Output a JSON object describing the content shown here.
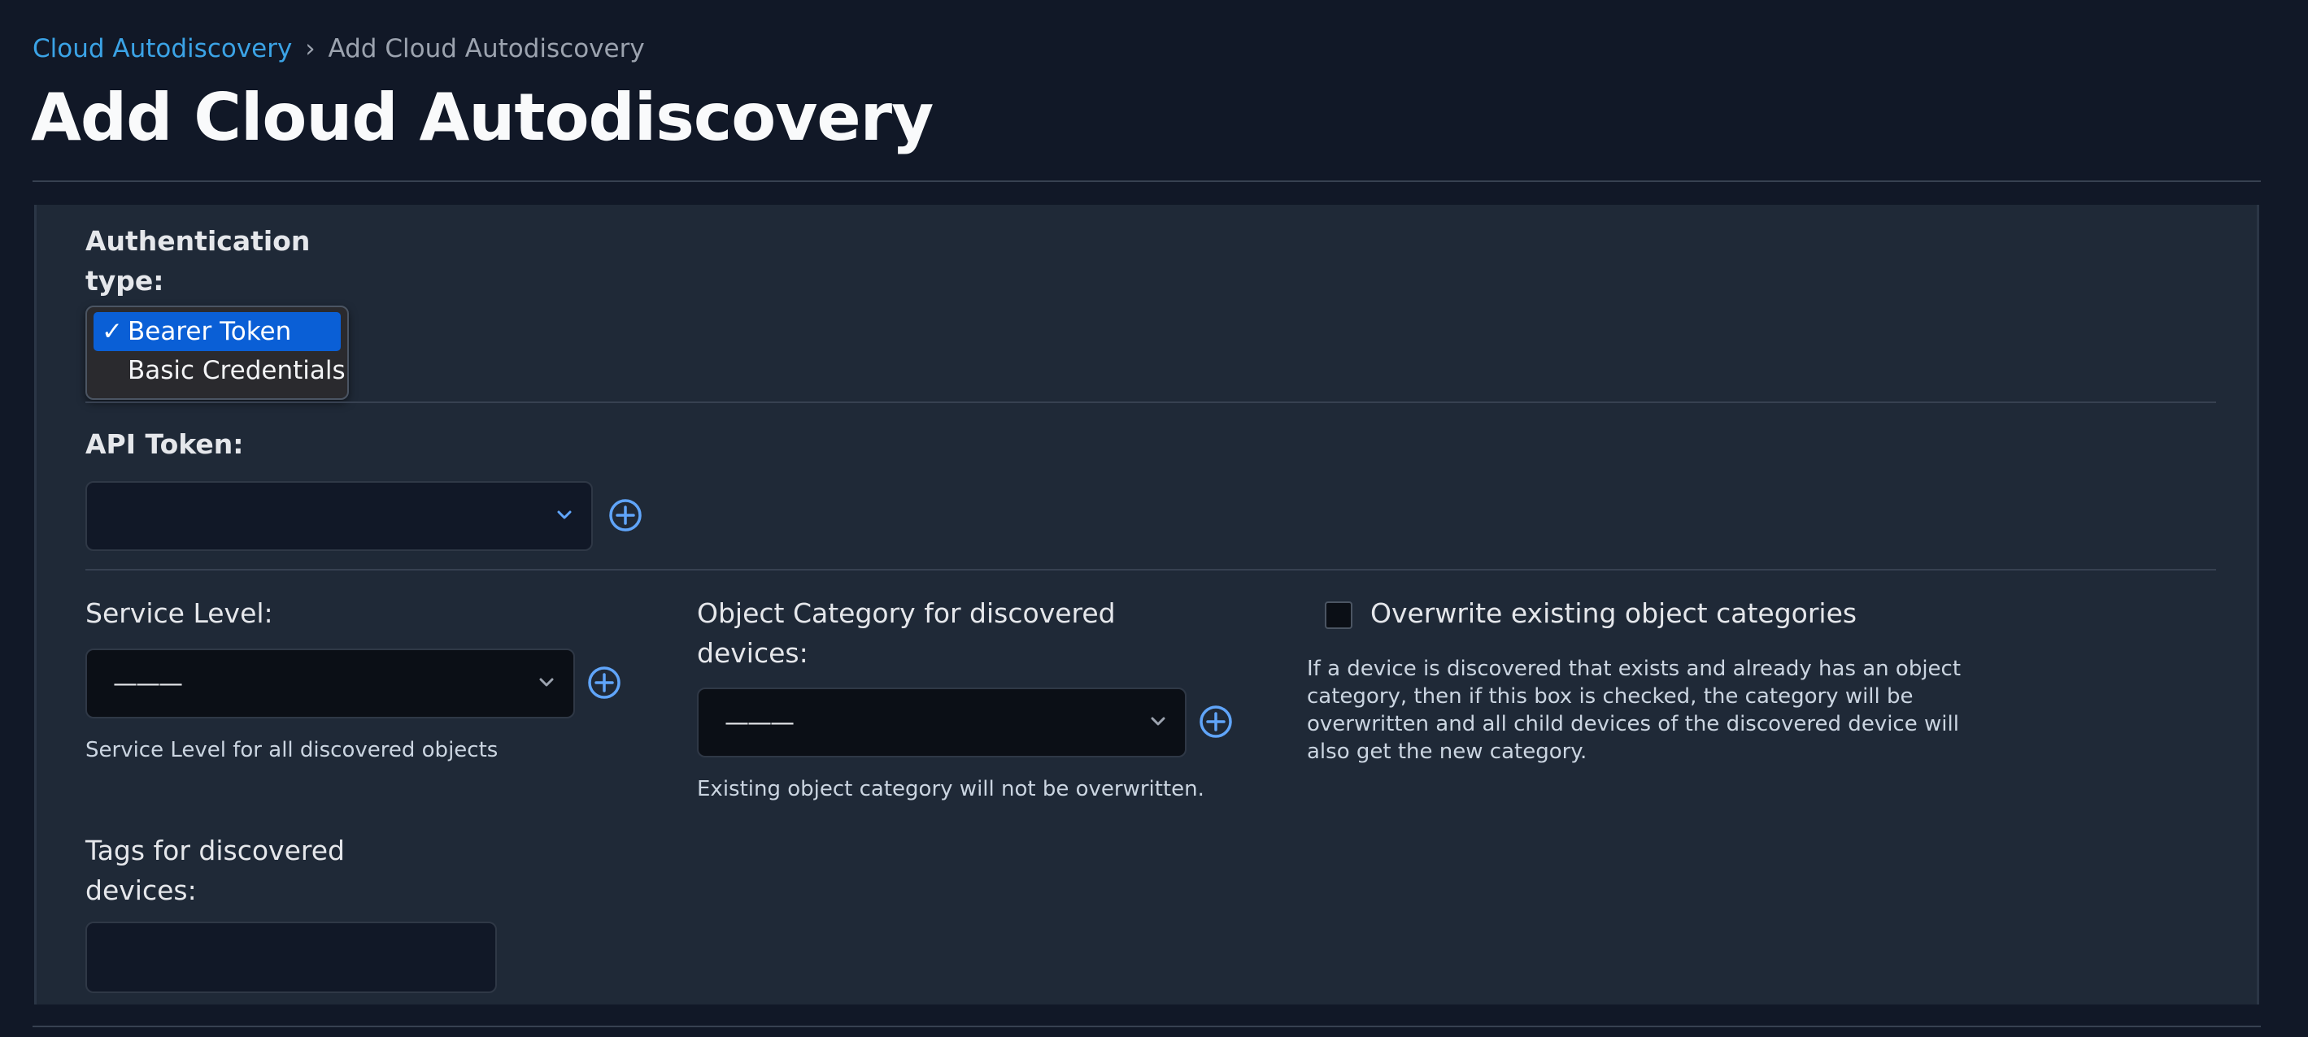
{
  "breadcrumb": {
    "parent": "Cloud Autodiscovery",
    "separator": "›",
    "current": "Add Cloud Autodiscovery"
  },
  "page": {
    "title": "Add Cloud Autodiscovery"
  },
  "auth": {
    "label": "Authentication type:",
    "options": [
      {
        "label": "Bearer Token",
        "selected": true
      },
      {
        "label": "Basic Credentials",
        "selected": false
      }
    ],
    "check_mark": "✓"
  },
  "api_token": {
    "label": "API Token:",
    "value": ""
  },
  "service_level": {
    "label": "Service Level:",
    "value": "———",
    "help": "Service Level for all discovered objects"
  },
  "object_category": {
    "label": "Object Category for discovered devices:",
    "value": "———",
    "help": "Existing object category will not be overwritten."
  },
  "overwrite": {
    "label": "Overwrite existing object categories",
    "checked": false,
    "help": "If a device is discovered that exists and already has an object category, then if this box is checked, the category will be overwritten and all child devices of the discovered device will also get the new category."
  },
  "tags": {
    "label": "Tags for discovered devices:",
    "value": ""
  },
  "colors": {
    "background": "#111827",
    "panel": "#1f2937",
    "link": "#3ba3e6",
    "selected": "#0a5fd6",
    "add_icon": "#60a5fa"
  }
}
